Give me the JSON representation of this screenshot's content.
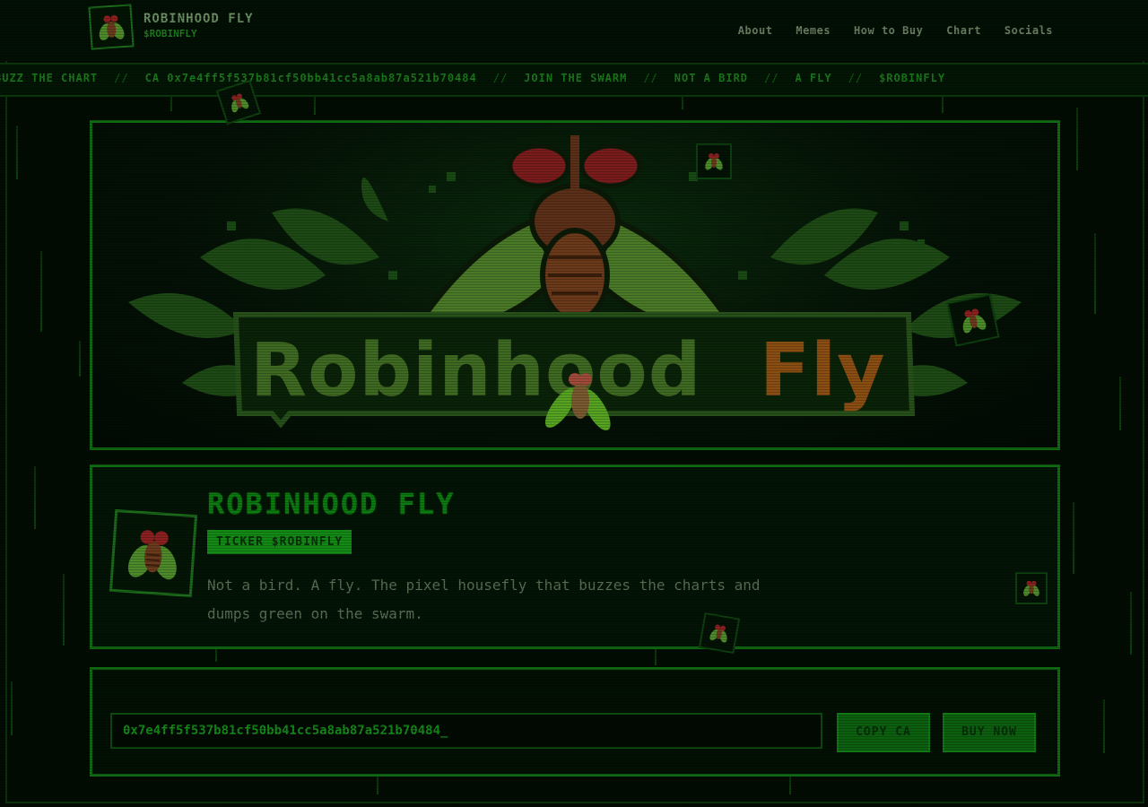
{
  "brand": {
    "name": "ROBINHOOD FLY",
    "ticker": "$ROBINFLY"
  },
  "nav": [
    {
      "label": "About"
    },
    {
      "label": "Memes"
    },
    {
      "label": "How to Buy"
    },
    {
      "label": "Chart"
    },
    {
      "label": "Socials"
    }
  ],
  "marquee": {
    "items": [
      "BUZZ THE CHART",
      "CA 0x7e4ff5f537b81cf50bb41cc5a8ab87a521b70484",
      "JOIN THE SWARM",
      "NOT A BIRD",
      "A FLY",
      "$ROBINFLY"
    ],
    "separator": "//"
  },
  "banner": {
    "wordmark_part1": "Robinhood",
    "wordmark_part2": "Fly"
  },
  "info": {
    "title": "ROBINHOOD FLY",
    "badge": "TICKER $ROBINFLY",
    "description": "Not a bird. A fly. The pixel housefly that buzzes the charts and dumps green on the swarm."
  },
  "contract": {
    "value": "0x7e4ff5f537b81cf50bb41cc5a8ab87a521b70484_",
    "copy_label": "COPY CA",
    "buy_label": "BUY NOW"
  },
  "colors": {
    "background": "#020c03",
    "accent": "#138a16",
    "border": "#0f6a12",
    "wordmark_orange": "#a05a12"
  },
  "icons": [
    "fly-logo-icon",
    "fly-avatar-icon",
    "fly-sticker-icon"
  ]
}
